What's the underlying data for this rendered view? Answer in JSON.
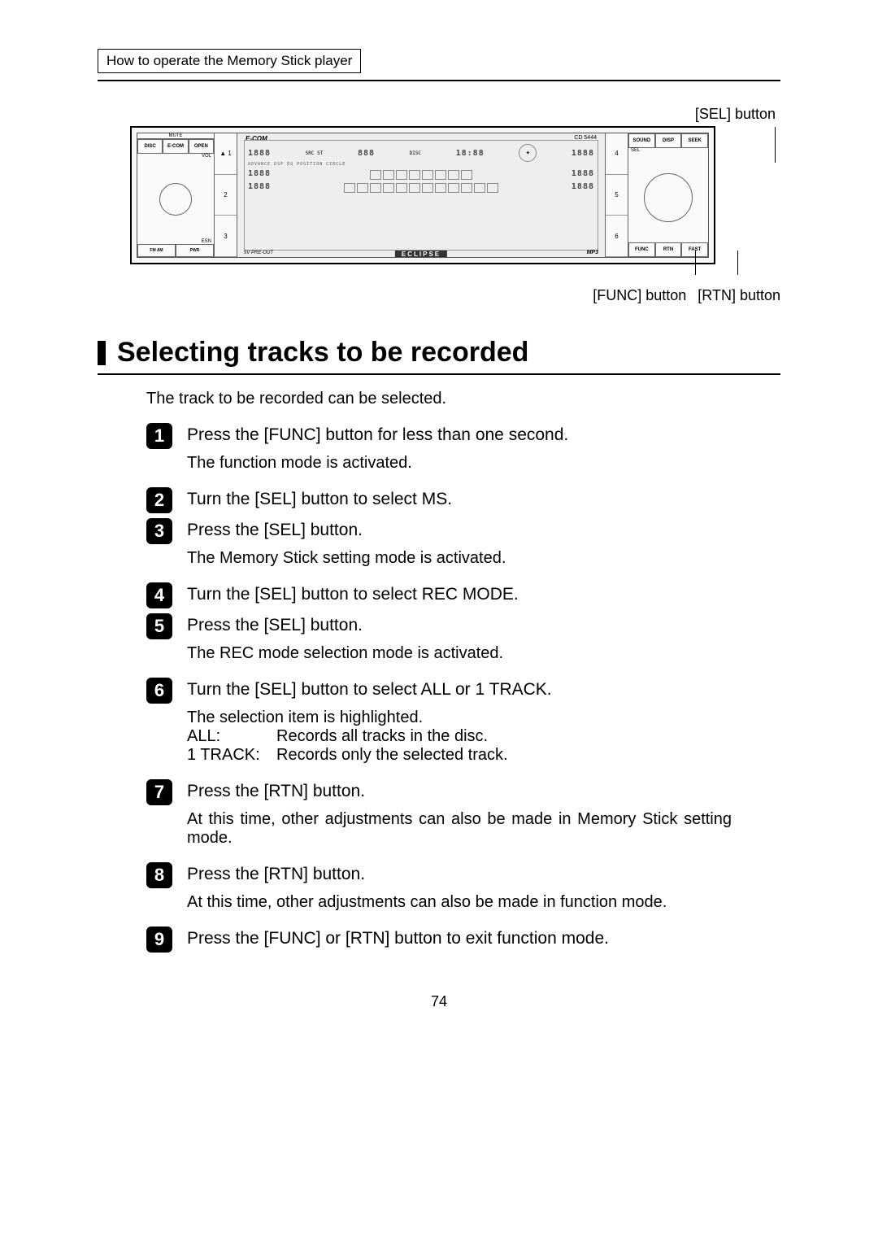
{
  "header_tab": "How to operate the Memory Stick player",
  "callouts": {
    "sel": "[SEL] button",
    "func": "[FUNC] button",
    "rtn": "[RTN] button"
  },
  "device": {
    "top_left_buttons": [
      "DISC",
      "E-COM",
      "OPEN"
    ],
    "mute_label": "MUTE",
    "vol_label": "VOL",
    "esn_label": "ESN",
    "fm_am_label": "FM AM",
    "pwr_label": "PWR",
    "left_numbers": [
      "1",
      "2",
      "3"
    ],
    "eject_symbol": "▲",
    "screen_brand": "E-COM",
    "screen_model": "CD 5444",
    "screen_disc_label": "DISC",
    "screen_src_label": "SRC",
    "screen_st_label": "ST",
    "seg_line1_a": "1888",
    "seg_line1_b": "888",
    "seg_line1_time": "18:88",
    "seg_side": "1888",
    "indicator_row": "ADVANCE  DSP  EQ  POSITION  CIRCLE",
    "preout_label": "5V PRE-OUT",
    "mp3_label": "MP3",
    "eclipse_label": "ECLIPSE",
    "right_numbers": [
      "4",
      "5",
      "6"
    ],
    "right_top_buttons": [
      "SOUND",
      "DISP",
      "SEEK"
    ],
    "sel_knob_label": "SEL",
    "right_bottom_buttons": [
      "FUNC",
      "RTN",
      "FAST"
    ]
  },
  "section_title": "Selecting tracks to be recorded",
  "intro": "The track to be recorded can be selected.",
  "steps": [
    {
      "num": "1",
      "title": "Press the [FUNC] button for less than one second.",
      "body": "The function mode is activated."
    },
    {
      "num": "2",
      "title": "Turn the [SEL] button to select MS.",
      "body": ""
    },
    {
      "num": "3",
      "title": "Press the [SEL] button.",
      "body": "The Memory Stick setting mode is activated."
    },
    {
      "num": "4",
      "title": "Turn the [SEL] button to select REC MODE.",
      "body": ""
    },
    {
      "num": "5",
      "title": "Press the [SEL] button.",
      "body": "The REC mode selection mode is activated."
    },
    {
      "num": "6",
      "title": "Turn the [SEL] button to select ALL or 1 TRACK.",
      "body_intro": "The selection item is highlighted.",
      "defs": [
        {
          "label": "ALL:",
          "text": "Records all tracks in the disc."
        },
        {
          "label": "1 TRACK:",
          "text": "Records only the selected track."
        }
      ]
    },
    {
      "num": "7",
      "title": "Press the [RTN] button.",
      "body": "At this time, other adjustments can also be made in Memory Stick setting mode."
    },
    {
      "num": "8",
      "title": "Press the [RTN] button.",
      "body": "At this time, other adjustments can also be made in function mode."
    },
    {
      "num": "9",
      "title": "Press the [FUNC] or [RTN] button to exit function mode.",
      "body": ""
    }
  ],
  "page_number": "74"
}
